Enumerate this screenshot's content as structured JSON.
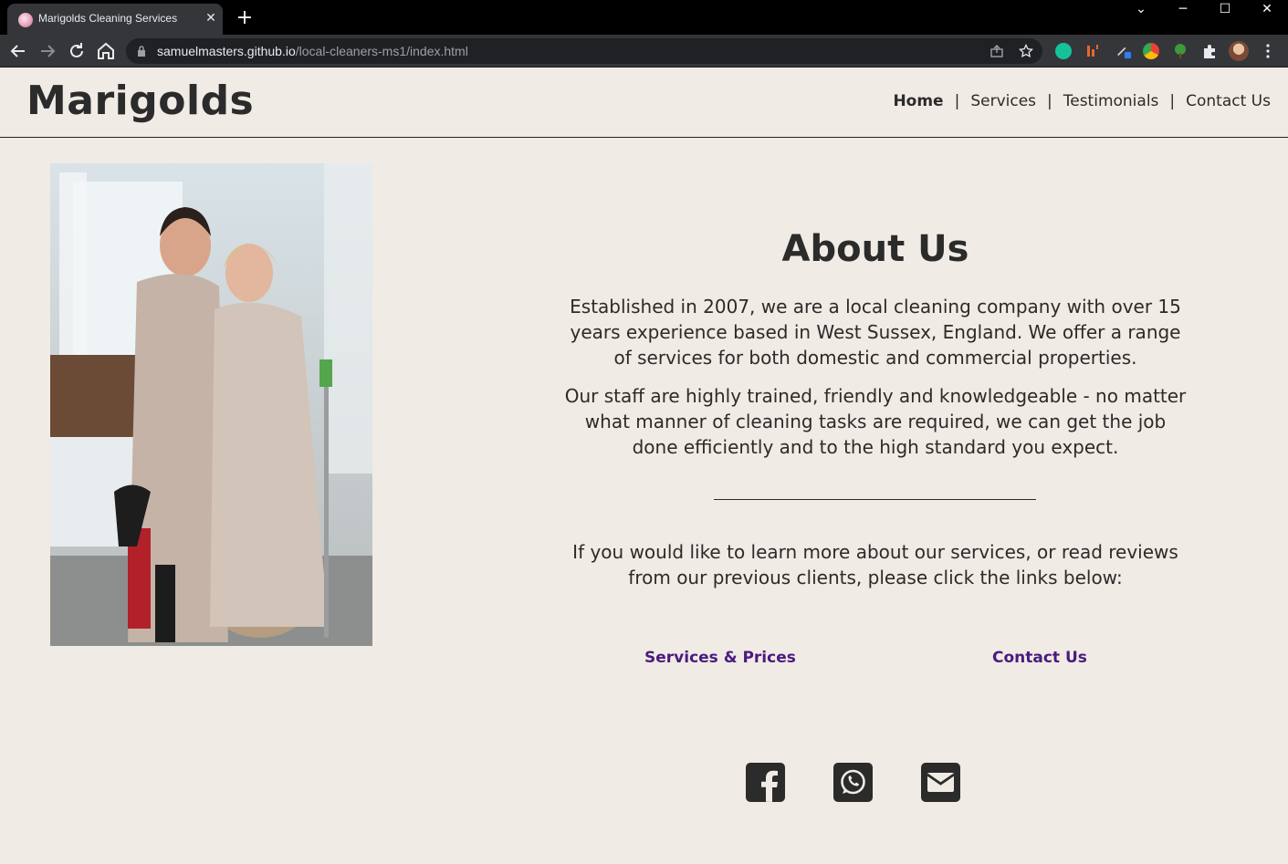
{
  "browser": {
    "tab_title": "Marigolds Cleaning Services",
    "tab_close": "✕",
    "new_tab": "+",
    "url_host": "samuelmasters.github.io",
    "url_path": "/local-cleaners-ms1/index.html",
    "window_controls": [
      "⌄",
      "─",
      "☐",
      "✕"
    ]
  },
  "site": {
    "brand": "Marigolds",
    "nav": [
      {
        "label": "Home",
        "active": true
      },
      {
        "label": "Services",
        "active": false
      },
      {
        "label": "Testimonials",
        "active": false
      },
      {
        "label": "Contact Us",
        "active": false
      }
    ],
    "nav_separator": "|"
  },
  "about": {
    "title": "About Us",
    "paragraph_1": "Established in 2007, we are a local cleaning company with over 15 years experience based in West Sussex, England. We offer a range of services for both domestic and commercial properties.",
    "paragraph_2": "Our staff are highly trained, friendly and knowledgeable - no matter what manner of cleaning tasks are required, we can get the job done efficiently and to the high standard you expect.",
    "cta_text": "If you would like to learn more about our services, or read reviews from our previous clients, please click the links below:",
    "link_services": "Services & Prices",
    "link_contact": "Contact Us"
  },
  "social_icons": [
    "facebook-icon",
    "whatsapp-icon",
    "email-icon"
  ],
  "colors": {
    "page_bg": "#f0ebe4",
    "text": "#2b2b2b",
    "link": "#4b1a80",
    "chrome_dark": "#35363a"
  }
}
